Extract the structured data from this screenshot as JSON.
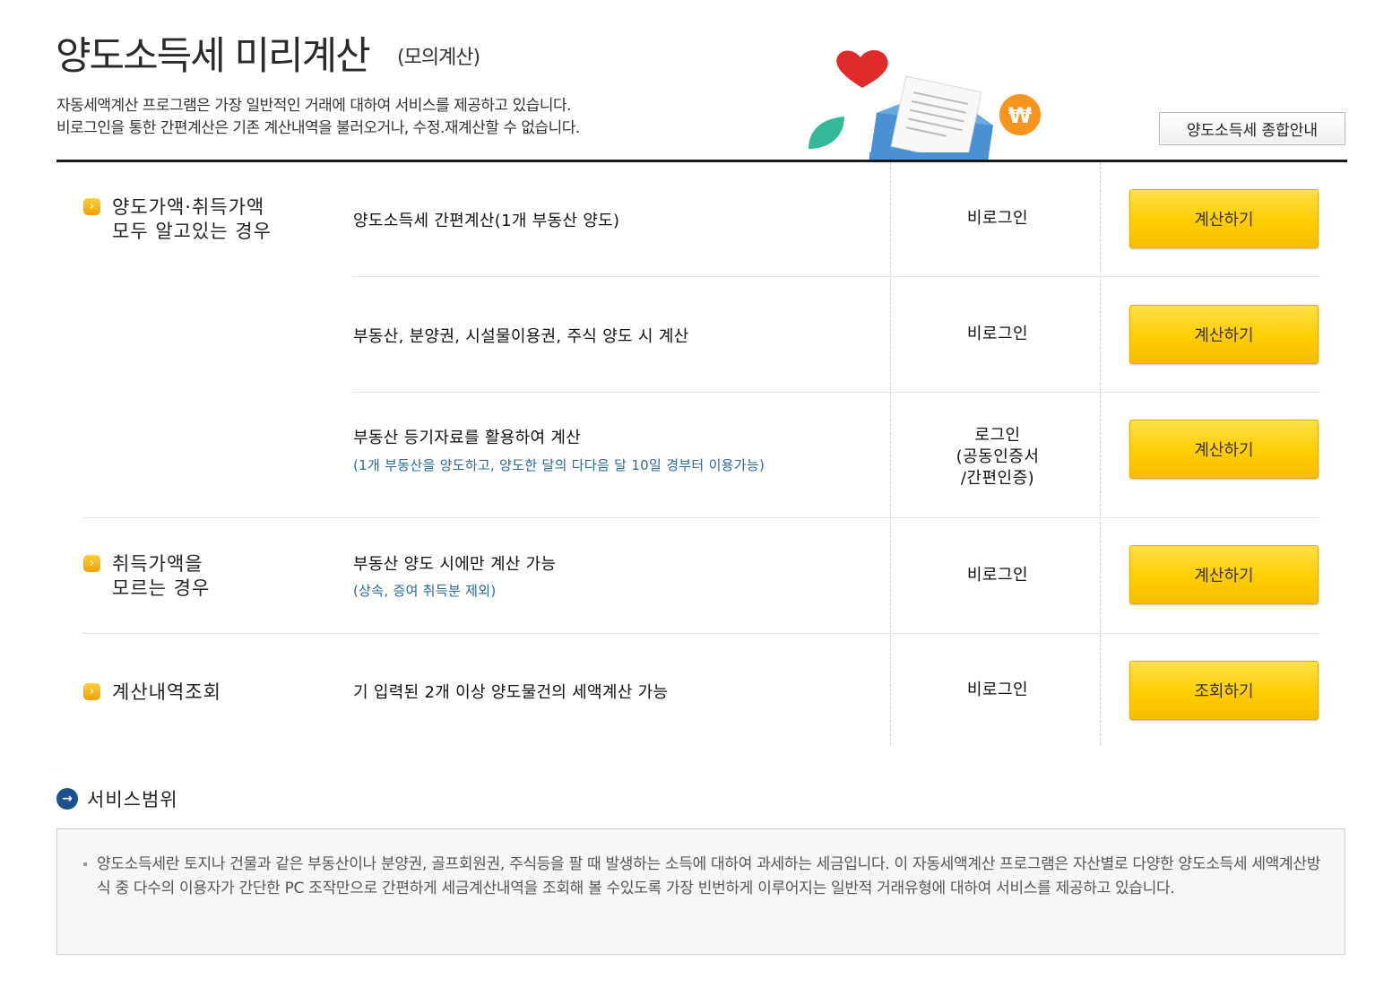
{
  "header": {
    "title": "양도소득세 미리계산",
    "subtitle": "(모의계산)",
    "desc_line1": "자동세액계산 프로그램은 가장 일반적인 거래에 대하여 서비스를 제공하고 있습니다.",
    "desc_line2": "비로그인을 통한 간편계산은 기존 계산내역을 불러오거나, 수정.재계산할 수 없습니다.",
    "guide_button": "양도소득세 종합안내"
  },
  "categories": {
    "known": {
      "line1": "양도가액·취득가액",
      "line2": "모두 알고있는 경우"
    },
    "unknown": {
      "line1": "취득가액을",
      "line2": "모르는 경우"
    },
    "history": {
      "line1": "계산내역조회"
    }
  },
  "rows": [
    {
      "title": "양도소득세 간편계산(1개 부동산 양도)",
      "note": "",
      "login": "비로그인",
      "button": "계산하기"
    },
    {
      "title": "부동산, 분양권, 시설물이용권, 주식 양도 시 계산",
      "note": "",
      "login": "비로그인",
      "button": "계산하기"
    },
    {
      "title": "부동산 등기자료를 활용하여 계산",
      "note": "(1개 부동산을 양도하고, 양도한 달의 다다음 달 10일 경부터 이용가능)",
      "login_line1": "로그인",
      "login_line2": "(공동인증서",
      "login_line3": "/간편인증)",
      "button": "계산하기"
    },
    {
      "title": "부동산 양도 시에만 계산 가능",
      "note": "(상속, 증여 취득분 제외)",
      "login": "비로그인",
      "button": "계산하기"
    },
    {
      "title": "기 입력된 2개 이상 양도물건의 세액계산 가능",
      "note": "",
      "login": "비로그인",
      "button": "조회하기"
    }
  ],
  "service": {
    "title": "서비스범위",
    "text": "양도소득세란 토지나 건물과 같은 부동산이나 분양권, 골프회원권, 주식등을 팔 때 발생하는 소득에 대하여 과세하는 세금입니다. 이 자동세액계산 프로그램은 자산별로 다양한 양도소득세 세액계산방식 중 다수의 이용자가 간단한 PC 조작만으로 간편하게 세금계산내역을 조회해 볼 수있도록 가장 빈번하게 이루어지는 일반적 거래유형에 대하여 서비스를 제공하고 있습니다."
  },
  "icons": {
    "category_bullet": "chevron-right-icon",
    "service_bullet": "arrow-right-circle-icon",
    "won": "₩"
  },
  "colors": {
    "button_yellow": "#ffcd00",
    "note_blue": "#2a6a9a",
    "service_icon_blue": "#1e4f8f",
    "won_orange": "#f7941d",
    "heart_red": "#e02a2a",
    "leaf_green": "#35b89a",
    "envelope_blue": "#4a90d2"
  }
}
